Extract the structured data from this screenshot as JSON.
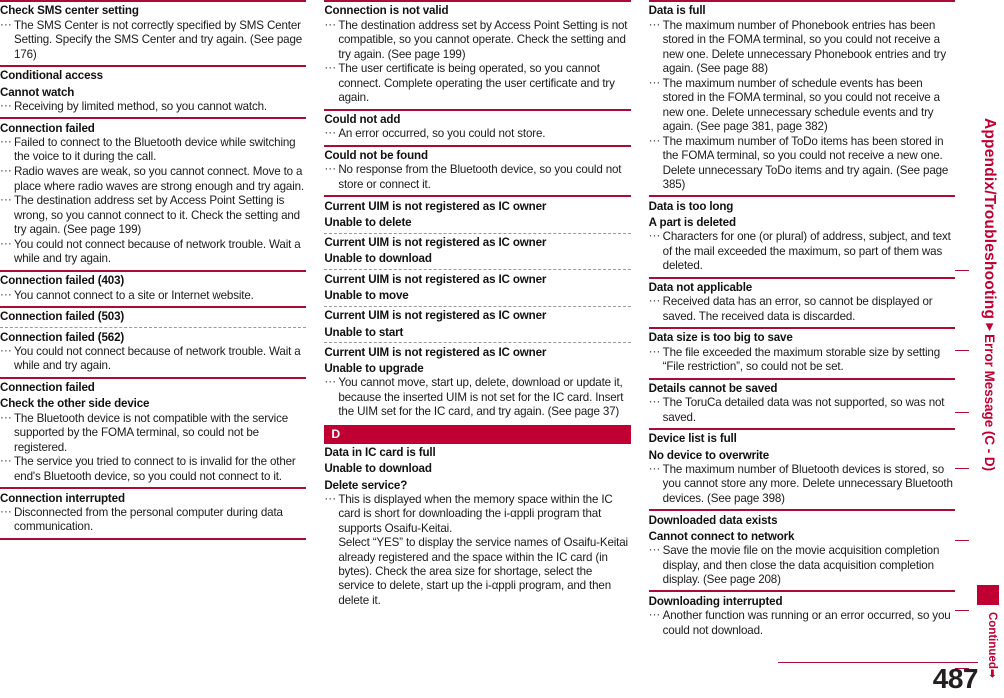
{
  "page": {
    "number": "487",
    "margin_tab": {
      "chapter": "Appendix/Troubleshooting",
      "section": "▼Error Message (C - D)",
      "continued": "Continued",
      "continued_arrow": "➡"
    },
    "accent_color": "#c00033",
    "rule_color": "#ab0c37"
  },
  "columns": [
    {
      "entries": [
        {
          "separator": "solid",
          "terms": [
            "Check SMS center setting"
          ],
          "descriptions": [
            "The SMS Center is not correctly specified by SMS Center Setting. Specify the SMS Center and try again. (See page 176)"
          ]
        },
        {
          "separator": "solid",
          "terms": [
            "Conditional access",
            "Cannot watch"
          ],
          "descriptions": [
            "Receiving by limited method, so you cannot watch."
          ]
        },
        {
          "separator": "solid",
          "terms": [
            "Connection failed"
          ],
          "descriptions": [
            "Failed to connect to the Bluetooth device while switching the voice to it during the call.",
            "Radio waves are weak, so you cannot connect. Move to a place where radio waves are strong enough and try again.",
            "The destination address set by Access Point Setting is wrong, so you cannot connect to it. Check the setting and try again. (See page 199)",
            "You could not connect because of network trouble. Wait a while and try again."
          ]
        },
        {
          "separator": "solid",
          "terms": [
            "Connection failed (403)"
          ],
          "descriptions": [
            "You cannot connect to a site or Internet website."
          ]
        },
        {
          "separator": "solid",
          "terms": [
            "Connection failed (503)"
          ],
          "descriptions": []
        },
        {
          "separator": "dashed",
          "terms": [
            "Connection failed (562)"
          ],
          "descriptions": [
            "You could not connect because of network trouble. Wait a while and try again."
          ]
        },
        {
          "separator": "solid",
          "terms": [
            "Connection failed",
            "Check the other side device"
          ],
          "descriptions": [
            "The Bluetooth device is not compatible with the service supported by the FOMA terminal, so could not be registered.",
            "The service you tried to connect to is invalid for the other end's Bluetooth device, so you could not connect to it."
          ]
        },
        {
          "separator": "solid",
          "terms": [
            "Connection interrupted"
          ],
          "descriptions": [
            "Disconnected from the personal computer during data communication."
          ]
        },
        {
          "separator": "solid",
          "terms": [],
          "descriptions": []
        }
      ]
    },
    {
      "entries": [
        {
          "separator": "solid",
          "terms": [
            "Connection is not valid"
          ],
          "descriptions": [
            "The destination address set by Access Point Setting is not compatible, so you cannot operate. Check the setting and try again. (See page 199)",
            "The user certificate is being operated, so you cannot connect. Complete operating the user certificate and try again."
          ]
        },
        {
          "separator": "solid",
          "terms": [
            "Could not add"
          ],
          "descriptions": [
            "An error occurred, so you could not store."
          ]
        },
        {
          "separator": "solid",
          "terms": [
            "Could not be found"
          ],
          "descriptions": [
            "No response from the Bluetooth device, so you could not store or connect it."
          ]
        },
        {
          "separator": "solid",
          "terms": [
            "Current UIM is not registered as IC owner",
            "Unable to delete"
          ],
          "descriptions": []
        },
        {
          "separator": "dashed",
          "terms": [
            "Current UIM is not registered as IC owner",
            "Unable to download"
          ],
          "descriptions": []
        },
        {
          "separator": "dashed",
          "terms": [
            "Current UIM is not registered as IC owner",
            "Unable to move"
          ],
          "descriptions": []
        },
        {
          "separator": "dashed",
          "terms": [
            "Current UIM is not registered as IC owner",
            "Unable to start"
          ],
          "descriptions": []
        },
        {
          "separator": "dashed",
          "terms": [
            "Current UIM is not registered as IC owner",
            "Unable to upgrade"
          ],
          "descriptions": [
            "You cannot move, start up, delete, download or update it, because the inserted UIM is not set for the IC card. Insert the UIM set for the IC card, and try again. (See page 37)"
          ]
        },
        {
          "section_letter": "D",
          "terms": [
            "Data in IC card is full",
            "Unable to download",
            "Delete service?"
          ],
          "descriptions": [
            "This is displayed when the memory space within the IC card is short for downloading the i-αppli program that supports Osaifu-Keitai.\nSelect “YES” to display the service names of Osaifu-Keitai already registered and the space within the IC card (in bytes). Check the area size for shortage, select the service to delete, start up the i-αppli program, and then delete it."
          ]
        }
      ]
    },
    {
      "entries": [
        {
          "separator": "solid",
          "terms": [
            "Data is full"
          ],
          "descriptions": [
            "The maximum number of Phonebook entries has been stored in the FOMA terminal, so you could not receive a new one. Delete unnecessary Phonebook entries and try again. (See page 88)",
            "The maximum number of schedule events has been stored in the FOMA terminal, so you could not receive a new one. Delete unnecessary schedule events and try again. (See page 381, page 382)",
            "The maximum number of ToDo items has been stored in the FOMA terminal, so you could not receive a new one. Delete unnecessary ToDo items and try again. (See page 385)"
          ]
        },
        {
          "separator": "solid",
          "terms": [
            "Data is too long",
            "A part is deleted"
          ],
          "descriptions": [
            "Characters for one (or plural) of address, subject, and text of the mail exceeded the maximum, so part of them was deleted."
          ]
        },
        {
          "separator": "solid",
          "terms": [
            "Data not applicable"
          ],
          "descriptions": [
            "Received data has an error, so cannot be displayed or saved. The received data is discarded."
          ]
        },
        {
          "separator": "solid",
          "terms": [
            "Data size is too big to save"
          ],
          "descriptions": [
            "The file exceeded the maximum storable size by setting “File restriction”, so could not be set."
          ]
        },
        {
          "separator": "solid",
          "terms": [
            "Details cannot be saved"
          ],
          "descriptions": [
            "The ToruCa detailed data was not supported, so was not saved."
          ]
        },
        {
          "separator": "solid",
          "terms": [
            "Device list is full",
            "No device to overwrite"
          ],
          "descriptions": [
            "The maximum number of Bluetooth devices is stored, so you cannot store any more. Delete unnecessary Bluetooth devices. (See page 398)"
          ]
        },
        {
          "separator": "solid",
          "terms": [
            "Downloaded data exists",
            "Cannot connect to network"
          ],
          "descriptions": [
            "Save the movie file on the movie acquisition completion display, and then close the data acquisition completion display. (See page 208)"
          ]
        },
        {
          "separator": "solid",
          "terms": [
            "Downloading interrupted"
          ],
          "descriptions": [
            "Another function was running or an error occurred, so you could not download."
          ]
        }
      ]
    }
  ]
}
